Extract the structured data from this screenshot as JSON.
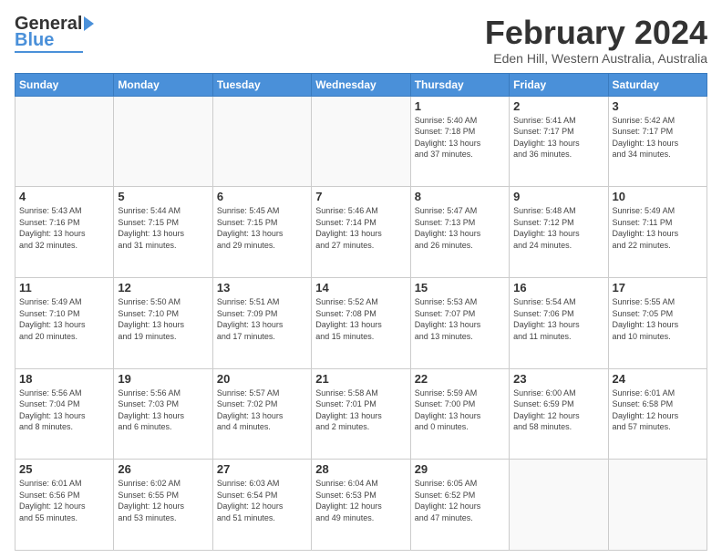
{
  "logo": {
    "line1": "General",
    "line2": "Blue"
  },
  "header": {
    "title": "February 2024",
    "subtitle": "Eden Hill, Western Australia, Australia"
  },
  "weekdays": [
    "Sunday",
    "Monday",
    "Tuesday",
    "Wednesday",
    "Thursday",
    "Friday",
    "Saturday"
  ],
  "weeks": [
    [
      {
        "day": "",
        "info": ""
      },
      {
        "day": "",
        "info": ""
      },
      {
        "day": "",
        "info": ""
      },
      {
        "day": "",
        "info": ""
      },
      {
        "day": "1",
        "info": "Sunrise: 5:40 AM\nSunset: 7:18 PM\nDaylight: 13 hours\nand 37 minutes."
      },
      {
        "day": "2",
        "info": "Sunrise: 5:41 AM\nSunset: 7:17 PM\nDaylight: 13 hours\nand 36 minutes."
      },
      {
        "day": "3",
        "info": "Sunrise: 5:42 AM\nSunset: 7:17 PM\nDaylight: 13 hours\nand 34 minutes."
      }
    ],
    [
      {
        "day": "4",
        "info": "Sunrise: 5:43 AM\nSunset: 7:16 PM\nDaylight: 13 hours\nand 32 minutes."
      },
      {
        "day": "5",
        "info": "Sunrise: 5:44 AM\nSunset: 7:15 PM\nDaylight: 13 hours\nand 31 minutes."
      },
      {
        "day": "6",
        "info": "Sunrise: 5:45 AM\nSunset: 7:15 PM\nDaylight: 13 hours\nand 29 minutes."
      },
      {
        "day": "7",
        "info": "Sunrise: 5:46 AM\nSunset: 7:14 PM\nDaylight: 13 hours\nand 27 minutes."
      },
      {
        "day": "8",
        "info": "Sunrise: 5:47 AM\nSunset: 7:13 PM\nDaylight: 13 hours\nand 26 minutes."
      },
      {
        "day": "9",
        "info": "Sunrise: 5:48 AM\nSunset: 7:12 PM\nDaylight: 13 hours\nand 24 minutes."
      },
      {
        "day": "10",
        "info": "Sunrise: 5:49 AM\nSunset: 7:11 PM\nDaylight: 13 hours\nand 22 minutes."
      }
    ],
    [
      {
        "day": "11",
        "info": "Sunrise: 5:49 AM\nSunset: 7:10 PM\nDaylight: 13 hours\nand 20 minutes."
      },
      {
        "day": "12",
        "info": "Sunrise: 5:50 AM\nSunset: 7:10 PM\nDaylight: 13 hours\nand 19 minutes."
      },
      {
        "day": "13",
        "info": "Sunrise: 5:51 AM\nSunset: 7:09 PM\nDaylight: 13 hours\nand 17 minutes."
      },
      {
        "day": "14",
        "info": "Sunrise: 5:52 AM\nSunset: 7:08 PM\nDaylight: 13 hours\nand 15 minutes."
      },
      {
        "day": "15",
        "info": "Sunrise: 5:53 AM\nSunset: 7:07 PM\nDaylight: 13 hours\nand 13 minutes."
      },
      {
        "day": "16",
        "info": "Sunrise: 5:54 AM\nSunset: 7:06 PM\nDaylight: 13 hours\nand 11 minutes."
      },
      {
        "day": "17",
        "info": "Sunrise: 5:55 AM\nSunset: 7:05 PM\nDaylight: 13 hours\nand 10 minutes."
      }
    ],
    [
      {
        "day": "18",
        "info": "Sunrise: 5:56 AM\nSunset: 7:04 PM\nDaylight: 13 hours\nand 8 minutes."
      },
      {
        "day": "19",
        "info": "Sunrise: 5:56 AM\nSunset: 7:03 PM\nDaylight: 13 hours\nand 6 minutes."
      },
      {
        "day": "20",
        "info": "Sunrise: 5:57 AM\nSunset: 7:02 PM\nDaylight: 13 hours\nand 4 minutes."
      },
      {
        "day": "21",
        "info": "Sunrise: 5:58 AM\nSunset: 7:01 PM\nDaylight: 13 hours\nand 2 minutes."
      },
      {
        "day": "22",
        "info": "Sunrise: 5:59 AM\nSunset: 7:00 PM\nDaylight: 13 hours\nand 0 minutes."
      },
      {
        "day": "23",
        "info": "Sunrise: 6:00 AM\nSunset: 6:59 PM\nDaylight: 12 hours\nand 58 minutes."
      },
      {
        "day": "24",
        "info": "Sunrise: 6:01 AM\nSunset: 6:58 PM\nDaylight: 12 hours\nand 57 minutes."
      }
    ],
    [
      {
        "day": "25",
        "info": "Sunrise: 6:01 AM\nSunset: 6:56 PM\nDaylight: 12 hours\nand 55 minutes."
      },
      {
        "day": "26",
        "info": "Sunrise: 6:02 AM\nSunset: 6:55 PM\nDaylight: 12 hours\nand 53 minutes."
      },
      {
        "day": "27",
        "info": "Sunrise: 6:03 AM\nSunset: 6:54 PM\nDaylight: 12 hours\nand 51 minutes."
      },
      {
        "day": "28",
        "info": "Sunrise: 6:04 AM\nSunset: 6:53 PM\nDaylight: 12 hours\nand 49 minutes."
      },
      {
        "day": "29",
        "info": "Sunrise: 6:05 AM\nSunset: 6:52 PM\nDaylight: 12 hours\nand 47 minutes."
      },
      {
        "day": "",
        "info": ""
      },
      {
        "day": "",
        "info": ""
      }
    ]
  ]
}
